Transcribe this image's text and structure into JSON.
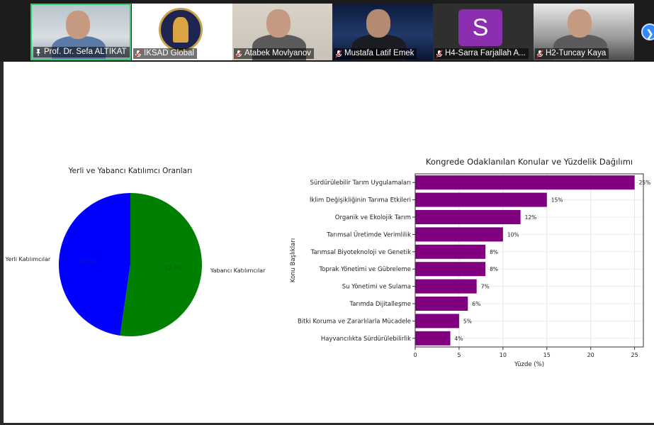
{
  "participants": [
    {
      "name": "Prof. Dr. Sefa ALTIKAT",
      "active": true
    },
    {
      "name": "IKSAD Global",
      "active": false
    },
    {
      "name": "Atabek Movlyanov",
      "active": false
    },
    {
      "name": "Mustafa Latif Emek",
      "active": false
    },
    {
      "name": "H4-Sarra Farjallah A...",
      "active": false,
      "avatar_letter": "S",
      "avatar_color": "#8b2fb0"
    },
    {
      "name": "H2-Tuncay Kaya",
      "active": false
    }
  ],
  "colors": {
    "accent_active": "#2ed06b",
    "muted_mic": "#e03b3b",
    "next_button": "#2d8cff",
    "pie_local": "#0000ff",
    "pie_foreign": "#008000",
    "bar": "#800080"
  },
  "icons": [
    "pin-icon",
    "muted-mic-icon",
    "chevron-right-icon"
  ],
  "chart_data": [
    {
      "type": "pie",
      "title": "Yerli ve Yabancı Katılımcı Oranları",
      "labels": [
        "Yerli Katılımcılar",
        "Yabancı Katılımcılar"
      ],
      "values": [
        47.7,
        52.3
      ],
      "pct_labels": [
        "47.7%",
        "52.3%"
      ],
      "colors": [
        "#0000ff",
        "#008000"
      ]
    },
    {
      "type": "bar",
      "orientation": "horizontal",
      "title": "Kongrede Odaklanılan Konular ve Yüzdelik Dağılımı",
      "xlabel": "Yüzde (%)",
      "ylabel": "Konu Başlıkları",
      "xlim": [
        0,
        26
      ],
      "xticks": [
        0,
        5,
        10,
        15,
        20,
        25
      ],
      "grid": true,
      "categories": [
        "Sürdürülebilir Tarım Uygulamaları",
        "İklim Değişikliğinin Tarıma Etkileri",
        "Organik ve Ekolojik Tarım",
        "Tarımsal Üretimde Verimlilik",
        "Tarımsal Biyoteknoloji ve Genetik",
        "Toprak Yönetimi ve Gübreleme",
        "Su Yönetimi ve Sulama",
        "Tarımda Dijitalleşme",
        "Bitki Koruma ve Zararlılarla Mücadele",
        "Hayvancılıkta Sürdürülebilirlik"
      ],
      "values": [
        25,
        15,
        12,
        10,
        8,
        8,
        7,
        6,
        5,
        4
      ],
      "value_labels": [
        "25%",
        "15%",
        "12%",
        "10%",
        "8%",
        "8%",
        "7%",
        "6%",
        "5%",
        "4%"
      ]
    }
  ]
}
